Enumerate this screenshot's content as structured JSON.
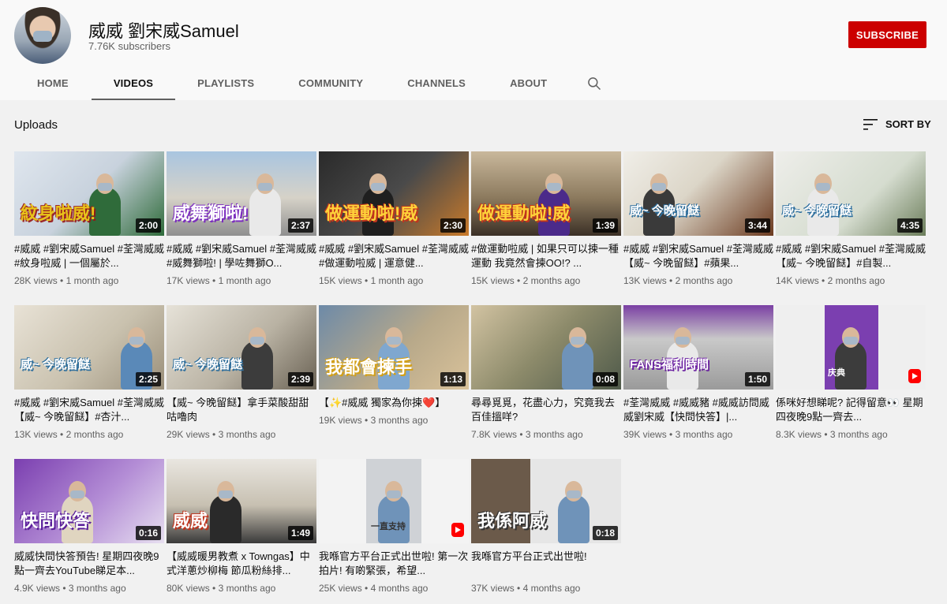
{
  "channel": {
    "name": "威威 劉宋威Samuel",
    "subscribers": "7.76K subscribers",
    "subscribe_label": "SUBSCRIBE"
  },
  "tabs": [
    {
      "label": "HOME"
    },
    {
      "label": "VIDEOS"
    },
    {
      "label": "PLAYLISTS"
    },
    {
      "label": "COMMUNITY"
    },
    {
      "label": "CHANNELS"
    },
    {
      "label": "ABOUT"
    }
  ],
  "uploads": {
    "title": "Uploads",
    "sort_label": "SORT BY"
  },
  "colors": {
    "subscribe": "#cc0000",
    "background": "#f1f1f1",
    "header": "#f9f9f9"
  },
  "videos": [
    {
      "title": "#威威 #劉宋威Samuel #荃灣威威 #紋身啦威 | 一個屬於...",
      "views": "28K views",
      "age": "1 month ago",
      "duration": "2:00",
      "overlay": "紋身啦威!"
    },
    {
      "title": "#威威 #劉宋威Samuel #荃灣威威 #威舞獅啦! | 學咗舞獅O...",
      "views": "17K views",
      "age": "1 month ago",
      "duration": "2:37",
      "overlay": "威舞獅啦!"
    },
    {
      "title": "#威威 #劉宋威Samuel #荃灣威威 #做運動啦威 | 運意健...",
      "views": "15K views",
      "age": "1 month ago",
      "duration": "2:30",
      "overlay": "做運動啦!威"
    },
    {
      "title": "#做運動啦威 | 如果只可以揀一種運動 我竟然會揀OO!? ...",
      "views": "15K views",
      "age": "2 months ago",
      "duration": "1:39",
      "overlay": "做運動啦!威"
    },
    {
      "title": "#威威 #劉宋威Samuel #荃灣威威【威~ 今晚留餸】#蘋果...",
      "views": "13K views",
      "age": "2 months ago",
      "duration": "3:44",
      "overlay": "威~ 今晚留餸"
    },
    {
      "title": "#威威 #劉宋威Samuel #荃灣威威【威~ 今晚留餸】#自製...",
      "views": "14K views",
      "age": "2 months ago",
      "duration": "4:35",
      "overlay": "威~ 今晚留餸"
    },
    {
      "title": "#威威 #劉宋威Samuel #荃灣威威【威~ 今晚留餸】#杏汁...",
      "views": "13K views",
      "age": "2 months ago",
      "duration": "2:25",
      "overlay": "威~ 今晚留餸"
    },
    {
      "title": "【威~ 今晚留餸】拿手菜酸甜甜咕嚕肉",
      "views": "29K views",
      "age": "3 months ago",
      "duration": "2:39",
      "overlay": "威~ 今晚留餸"
    },
    {
      "title": "【✨#威威 獨家為你揀❤️】",
      "views": "19K views",
      "age": "3 months ago",
      "duration": "1:13",
      "overlay": "我都會揀手"
    },
    {
      "title": "尋尋覓覓，花盡心力，究竟我去百佳搵咩?",
      "views": "7.8K views",
      "age": "3 months ago",
      "duration": "0:08",
      "overlay": ""
    },
    {
      "title": "#荃灣威威 #威威豬 #威威訪問威威劉宋威【快問快答】|...",
      "views": "39K views",
      "age": "3 months ago",
      "duration": "1:50",
      "overlay": "FANS福利時間"
    },
    {
      "title": "係咪好想睇呢? 記得留意👀 星期四夜晚9點一齊去...",
      "views": "8.3K views",
      "age": "3 months ago",
      "duration": "",
      "overlay": "庆典",
      "short": true
    },
    {
      "title": "威威快問快答預告! 星期四夜晚9點一齊去YouTube睇足本...",
      "views": "4.9K views",
      "age": "3 months ago",
      "duration": "0:16",
      "overlay": "快問快答"
    },
    {
      "title": "【威威暖男教煮 x Towngas】中式洋蔥炒柳梅 節瓜粉絲排...",
      "views": "80K views",
      "age": "3 months ago",
      "duration": "1:49",
      "overlay": "威威"
    },
    {
      "title": "我喺官方平台正式出世啦! 第一次拍片! 有啲緊張，希望...",
      "views": "25K views",
      "age": "4 months ago",
      "duration": "",
      "overlay": "一直支持",
      "short": true
    },
    {
      "title": "我喺官方平台正式出世啦!",
      "views": "37K views",
      "age": "4 months ago",
      "duration": "0:18",
      "overlay": "我係阿威"
    }
  ]
}
